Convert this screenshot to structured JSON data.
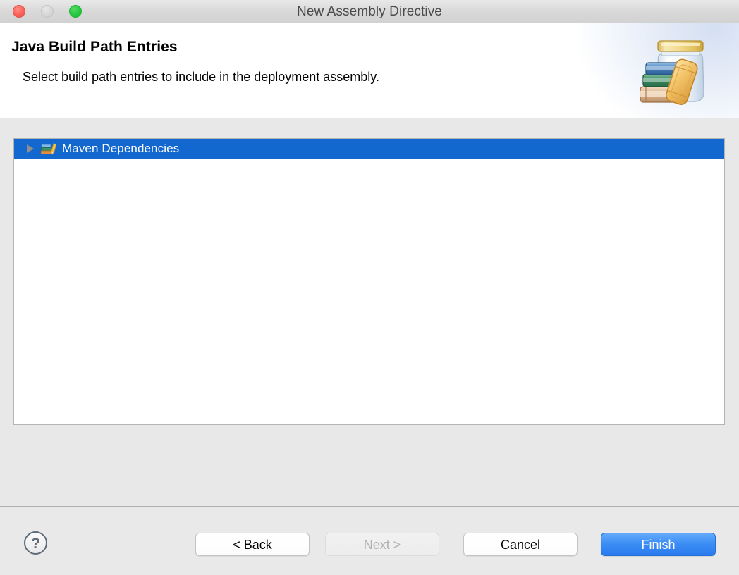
{
  "window": {
    "title": "New Assembly Directive",
    "traffic_lights": [
      {
        "name": "close",
        "color": "#fb6058"
      },
      {
        "name": "minimize",
        "color": "#d6d6d6"
      },
      {
        "name": "maximize",
        "color": "#28c840"
      }
    ]
  },
  "header": {
    "title": "Java Build Path Entries",
    "subtitle": "Select build path entries to include in the deployment assembly.",
    "icon": "jar-with-cookies-icon"
  },
  "tree": {
    "items": [
      {
        "label": "Maven Dependencies",
        "icon": "maven-dependencies-library-icon",
        "twisty": "chevron-right-icon",
        "expanded": false,
        "selected": true
      }
    ],
    "selection_color": "#1368d0"
  },
  "footer": {
    "help_label": "?",
    "buttons": [
      {
        "name": "back",
        "label": "< Back",
        "state": "enabled"
      },
      {
        "name": "next",
        "label": "Next >",
        "state": "disabled"
      },
      {
        "name": "cancel",
        "label": "Cancel",
        "state": "enabled"
      },
      {
        "name": "finish",
        "label": "Finish",
        "state": "primary"
      }
    ],
    "primary_color": "#3b8df4"
  }
}
